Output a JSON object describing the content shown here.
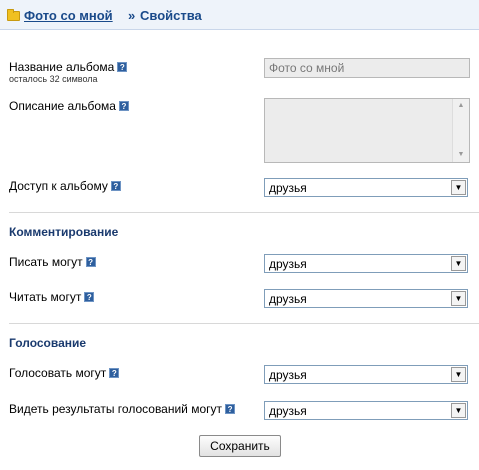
{
  "breadcrumb": {
    "album_link": "Фото со мной",
    "separator": "»",
    "current": "Свойства"
  },
  "album_name": {
    "label": "Название альбома",
    "hint": "осталось 32 символа",
    "value": "Фото со мной"
  },
  "album_description": {
    "label": "Описание альбома",
    "value": ""
  },
  "album_access": {
    "label": "Доступ к альбому",
    "value": "друзья"
  },
  "commenting": {
    "title": "Комментирование",
    "write_label": "Писать могут",
    "write_value": "друзья",
    "read_label": "Читать могут",
    "read_value": "друзья"
  },
  "voting": {
    "title": "Голосование",
    "vote_label": "Голосовать могут",
    "vote_value": "друзья",
    "results_label": "Видеть результаты голосований могут",
    "results_value": "друзья"
  },
  "help_glyph": "?",
  "select_arrow_glyph": "▼",
  "scroll_up_glyph": "▲",
  "scroll_down_glyph": "▼",
  "save_button": "Сохранить",
  "colors": {
    "link": "#1a4a8a",
    "section_title": "#1a3a6e",
    "header_bg": "#eef3fa",
    "help_icon": "#2e5f9e"
  }
}
